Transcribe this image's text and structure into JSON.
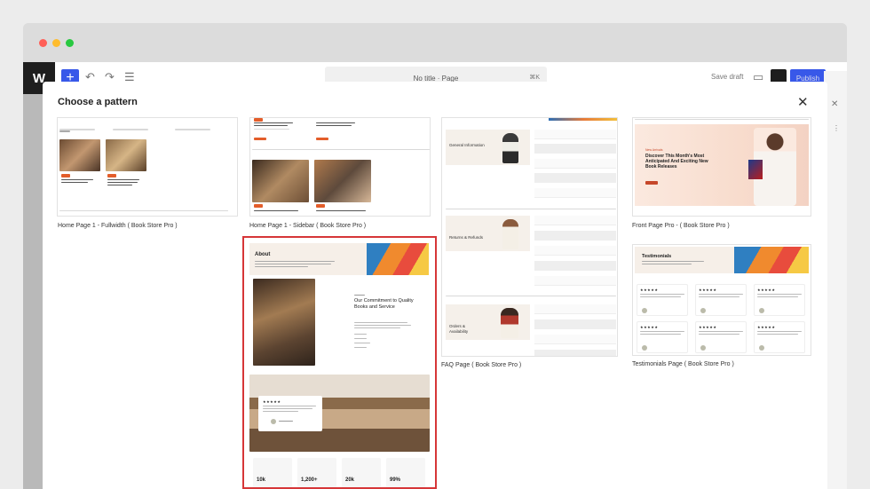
{
  "editor": {
    "doc_title": "No title · Page",
    "shortcut": "⌘K",
    "save_draft": "Save draft",
    "publish": "Publish"
  },
  "modal": {
    "title": "Choose a pattern",
    "close_icon": "close-icon"
  },
  "patterns": [
    {
      "label": "Home Page 1 - Fullwidth ( Book Store Pro )",
      "selected": false
    },
    {
      "label": "Home Page 1 - Sidebar ( Book Store Pro )",
      "selected": false
    },
    {
      "label": "FAQ Page ( Book Store Pro )",
      "selected": false
    },
    {
      "label": "Front Page Pro - ( Book Store Pro )",
      "selected": false
    },
    {
      "label": "About",
      "selected": true
    },
    {
      "label": "Testimonials Page ( Book Store Pro )",
      "selected": false
    }
  ],
  "about_preview": {
    "heading": "About",
    "commitment": "Our Commitment to Quality Books and Service",
    "stats": [
      "10k",
      "1,200+",
      "20k",
      "99%"
    ]
  },
  "faq_preview": {
    "sections": [
      "General Information",
      "Returns & Refunds",
      "Orders & Availability"
    ]
  },
  "front_preview": {
    "label": "New Arrivals",
    "heading": "Discover This Month's Most Anticipated And Exciting New Book Releases"
  },
  "testimonials_preview": {
    "heading": "Testimonials"
  },
  "colors": {
    "accent": "#3858e9",
    "selection": "#d63638",
    "tag": "#e35d2a"
  }
}
